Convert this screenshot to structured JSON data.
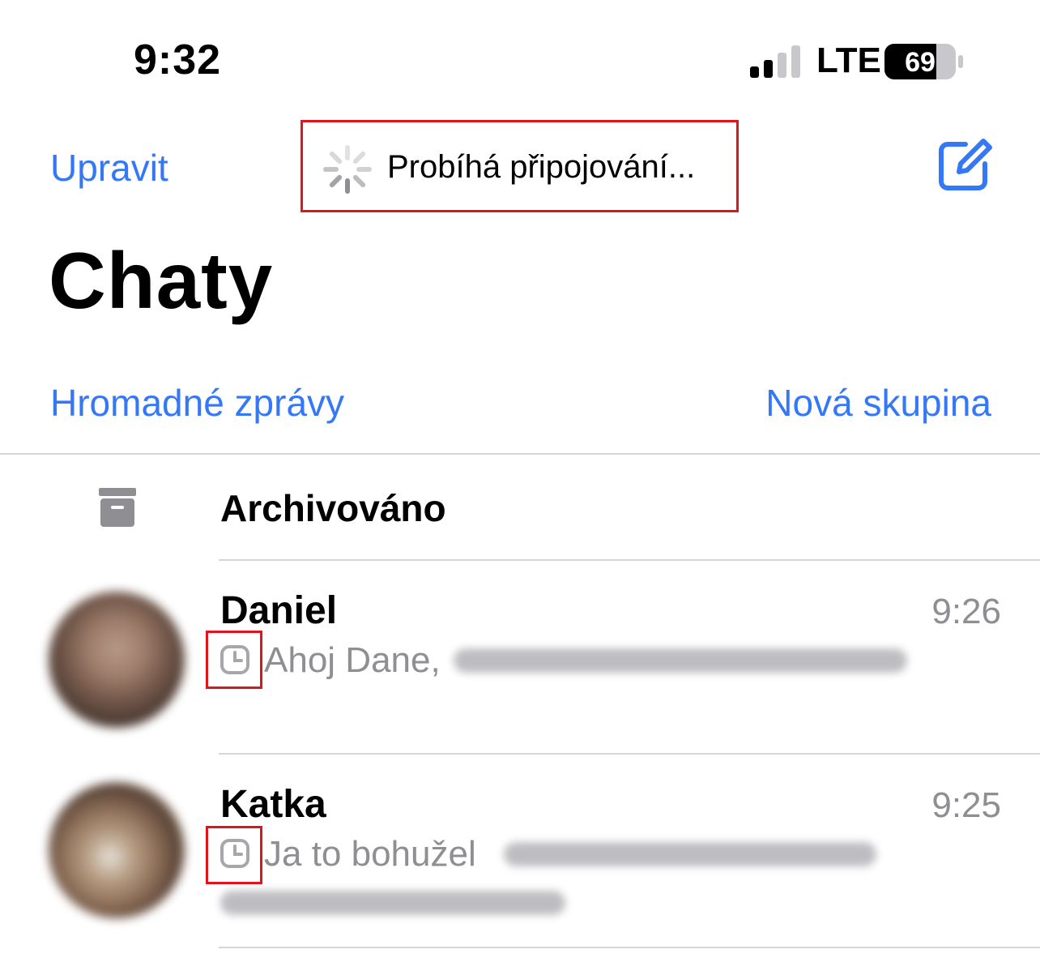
{
  "status_bar": {
    "time": "9:32",
    "network": "LTE",
    "battery": "69",
    "signal_bars_active": 2,
    "signal_bars_total": 4
  },
  "nav": {
    "edit_label": "Upravit",
    "connecting_text": "Probíhá připojování...",
    "compose_icon": "compose-icon"
  },
  "page": {
    "title": "Chaty"
  },
  "actions": {
    "broadcast_label": "Hromadné zprávy",
    "new_group_label": "Nová skupina"
  },
  "archived": {
    "label": "Archivováno",
    "icon": "archive-box-icon"
  },
  "chats": [
    {
      "name": "Daniel",
      "time": "9:26",
      "preview": "Ahoj Dane,",
      "status_icon": "clock-icon"
    },
    {
      "name": "Katka",
      "time": "9:25",
      "preview": "Ja to bohužel",
      "status_icon": "clock-icon"
    }
  ],
  "colors": {
    "accent": "#3478f6",
    "highlight": "#e0141c",
    "secondary_text": "#8e8e93",
    "separator": "#d6d6d9"
  }
}
